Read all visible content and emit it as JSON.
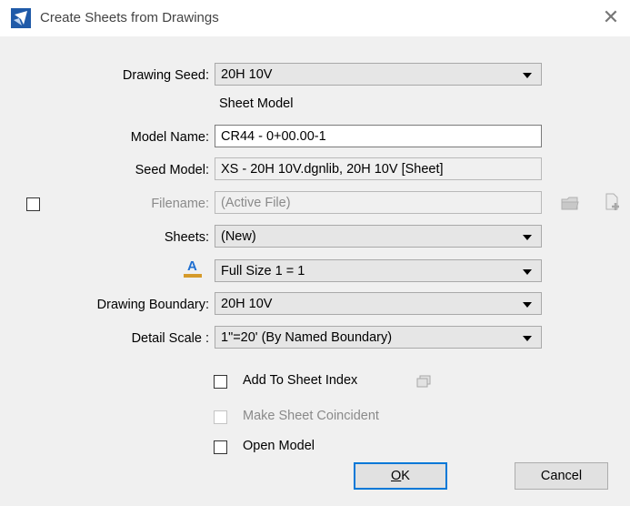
{
  "window": {
    "title": "Create Sheets from Drawings",
    "close_icon": "close-icon"
  },
  "form": {
    "drawing_seed": {
      "label": "Drawing Seed:",
      "value": "20H 10V"
    },
    "sheet_model_heading": "Sheet Model",
    "model_name": {
      "label": "Model Name:",
      "value": "CR44 - 0+00.00-1"
    },
    "seed_model": {
      "label": "Seed Model:",
      "value": "XS - 20H 10V.dgnlib, 20H 10V [Sheet]"
    },
    "filename": {
      "label": "Filename:",
      "value": "(Active File)",
      "checked": false
    },
    "sheets": {
      "label": "Sheets:",
      "value": "(New)"
    },
    "annotation_scale": {
      "value": "Full Size 1 = 1",
      "icon": "annotation-scale-icon",
      "icon_letter": "A"
    },
    "drawing_boundary": {
      "label": "Drawing Boundary:",
      "value": "20H 10V"
    },
    "detail_scale": {
      "label": "Detail Scale :",
      "value": "1\"=20' (By Named Boundary)"
    }
  },
  "options": {
    "add_to_sheet_index": {
      "label": "Add To Sheet Index",
      "checked": false,
      "enabled": true
    },
    "make_sheet_coincident": {
      "label": "Make Sheet Coincident",
      "checked": false,
      "enabled": false
    },
    "open_model": {
      "label": "Open Model",
      "checked": false,
      "enabled": true
    }
  },
  "buttons": {
    "ok_underlined": "O",
    "ok_rest": "K",
    "cancel": "Cancel"
  },
  "colors": {
    "accent": "#0078d7",
    "disabled_text": "#8a8a8a",
    "dialog_bg": "#f0f0f0"
  }
}
